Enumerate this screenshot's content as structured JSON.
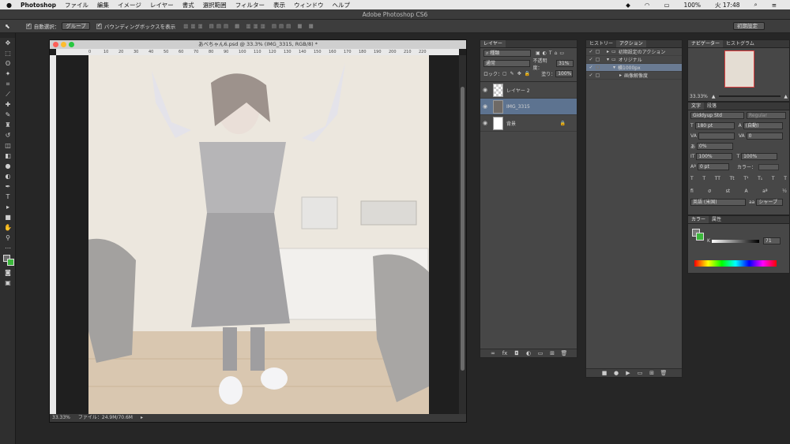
{
  "menubar": {
    "apple": "",
    "app": "Photoshop",
    "items": [
      "ファイル",
      "編集",
      "イメージ",
      "レイヤー",
      "書式",
      "選択範囲",
      "フィルター",
      "表示",
      "ウィンドウ",
      "ヘルプ"
    ],
    "right_status": "100%",
    "clock": "火 17:48"
  },
  "window_title": "Adobe Photoshop CS6",
  "options_bar": {
    "auto_select_label": "自動選択：",
    "auto_select_value": "グループ",
    "bbox_label": "バウンディングボックスを表示",
    "workspace": "初期設定"
  },
  "document": {
    "title": "あべちゃん6.psd @ 33.3% (IMG_3315, RGB/8) *",
    "zoom": "33.33%",
    "file_info": "ファイル：24.9M/70.6M",
    "ruler_ticks": [
      "0",
      "10",
      "20",
      "30",
      "40",
      "50",
      "60",
      "70",
      "80",
      "90",
      "100",
      "110",
      "120",
      "130",
      "140",
      "150",
      "160",
      "170",
      "180",
      "190",
      "200",
      "210",
      "220"
    ]
  },
  "layers_panel": {
    "tab": "レイヤー",
    "filter": "種類",
    "blend": "通常",
    "opacity_label": "不透明度：",
    "opacity": "31%",
    "lock_label": "ロック：",
    "fill_label": "塗り：",
    "fill": "100%",
    "layers": [
      {
        "name": "レイヤー 2",
        "selected": false
      },
      {
        "name": "IMG_3315",
        "selected": true
      },
      {
        "name": "背景",
        "selected": false
      }
    ]
  },
  "history_panel": {
    "tabs": [
      "ヒストリー",
      "アクション"
    ],
    "rows": [
      {
        "label": "初期設定のアクション",
        "indent": 1,
        "kind": "folder"
      },
      {
        "label": "オリジナル",
        "indent": 1,
        "kind": "folder"
      },
      {
        "label": "横1000px",
        "indent": 2,
        "kind": "action",
        "selected": true
      },
      {
        "label": "画像解像度",
        "indent": 3,
        "kind": "step"
      }
    ]
  },
  "navigator_panel": {
    "tabs": [
      "ナビゲーター",
      "ヒストグラム"
    ],
    "zoom": "33.33%"
  },
  "character_panel": {
    "tabs": [
      "文字",
      "段落"
    ],
    "font": "Giddyup Std",
    "style": "Regular",
    "size": "180 pt",
    "leading": "(自動)",
    "kerning": "",
    "tracking": "0",
    "vscale_pct": "0%",
    "scale_v": "100%",
    "scale_h": "100%",
    "baseline": "0 pt",
    "color_label": "カラー：",
    "language": "英語 (米国)",
    "antialias": "シャープ"
  },
  "color_panel": {
    "tabs": [
      "カラー",
      "属性"
    ],
    "k_label": "K",
    "k_value": "71"
  }
}
